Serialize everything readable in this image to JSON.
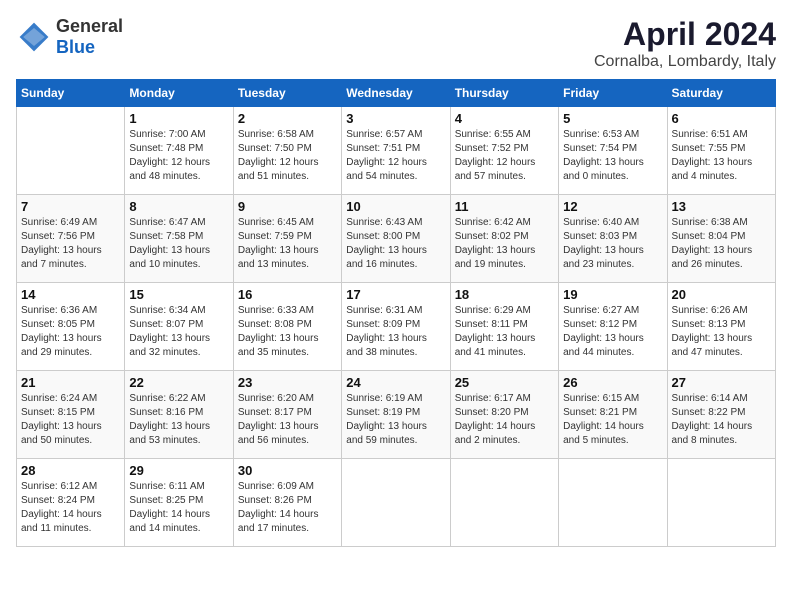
{
  "header": {
    "logo_general": "General",
    "logo_blue": "Blue",
    "month": "April 2024",
    "location": "Cornalba, Lombardy, Italy"
  },
  "weekdays": [
    "Sunday",
    "Monday",
    "Tuesday",
    "Wednesday",
    "Thursday",
    "Friday",
    "Saturday"
  ],
  "weeks": [
    [
      {
        "day": "",
        "sunrise": "",
        "sunset": "",
        "daylight": ""
      },
      {
        "day": "1",
        "sunrise": "Sunrise: 7:00 AM",
        "sunset": "Sunset: 7:48 PM",
        "daylight": "Daylight: 12 hours and 48 minutes."
      },
      {
        "day": "2",
        "sunrise": "Sunrise: 6:58 AM",
        "sunset": "Sunset: 7:50 PM",
        "daylight": "Daylight: 12 hours and 51 minutes."
      },
      {
        "day": "3",
        "sunrise": "Sunrise: 6:57 AM",
        "sunset": "Sunset: 7:51 PM",
        "daylight": "Daylight: 12 hours and 54 minutes."
      },
      {
        "day": "4",
        "sunrise": "Sunrise: 6:55 AM",
        "sunset": "Sunset: 7:52 PM",
        "daylight": "Daylight: 12 hours and 57 minutes."
      },
      {
        "day": "5",
        "sunrise": "Sunrise: 6:53 AM",
        "sunset": "Sunset: 7:54 PM",
        "daylight": "Daylight: 13 hours and 0 minutes."
      },
      {
        "day": "6",
        "sunrise": "Sunrise: 6:51 AM",
        "sunset": "Sunset: 7:55 PM",
        "daylight": "Daylight: 13 hours and 4 minutes."
      }
    ],
    [
      {
        "day": "7",
        "sunrise": "Sunrise: 6:49 AM",
        "sunset": "Sunset: 7:56 PM",
        "daylight": "Daylight: 13 hours and 7 minutes."
      },
      {
        "day": "8",
        "sunrise": "Sunrise: 6:47 AM",
        "sunset": "Sunset: 7:58 PM",
        "daylight": "Daylight: 13 hours and 10 minutes."
      },
      {
        "day": "9",
        "sunrise": "Sunrise: 6:45 AM",
        "sunset": "Sunset: 7:59 PM",
        "daylight": "Daylight: 13 hours and 13 minutes."
      },
      {
        "day": "10",
        "sunrise": "Sunrise: 6:43 AM",
        "sunset": "Sunset: 8:00 PM",
        "daylight": "Daylight: 13 hours and 16 minutes."
      },
      {
        "day": "11",
        "sunrise": "Sunrise: 6:42 AM",
        "sunset": "Sunset: 8:02 PM",
        "daylight": "Daylight: 13 hours and 19 minutes."
      },
      {
        "day": "12",
        "sunrise": "Sunrise: 6:40 AM",
        "sunset": "Sunset: 8:03 PM",
        "daylight": "Daylight: 13 hours and 23 minutes."
      },
      {
        "day": "13",
        "sunrise": "Sunrise: 6:38 AM",
        "sunset": "Sunset: 8:04 PM",
        "daylight": "Daylight: 13 hours and 26 minutes."
      }
    ],
    [
      {
        "day": "14",
        "sunrise": "Sunrise: 6:36 AM",
        "sunset": "Sunset: 8:05 PM",
        "daylight": "Daylight: 13 hours and 29 minutes."
      },
      {
        "day": "15",
        "sunrise": "Sunrise: 6:34 AM",
        "sunset": "Sunset: 8:07 PM",
        "daylight": "Daylight: 13 hours and 32 minutes."
      },
      {
        "day": "16",
        "sunrise": "Sunrise: 6:33 AM",
        "sunset": "Sunset: 8:08 PM",
        "daylight": "Daylight: 13 hours and 35 minutes."
      },
      {
        "day": "17",
        "sunrise": "Sunrise: 6:31 AM",
        "sunset": "Sunset: 8:09 PM",
        "daylight": "Daylight: 13 hours and 38 minutes."
      },
      {
        "day": "18",
        "sunrise": "Sunrise: 6:29 AM",
        "sunset": "Sunset: 8:11 PM",
        "daylight": "Daylight: 13 hours and 41 minutes."
      },
      {
        "day": "19",
        "sunrise": "Sunrise: 6:27 AM",
        "sunset": "Sunset: 8:12 PM",
        "daylight": "Daylight: 13 hours and 44 minutes."
      },
      {
        "day": "20",
        "sunrise": "Sunrise: 6:26 AM",
        "sunset": "Sunset: 8:13 PM",
        "daylight": "Daylight: 13 hours and 47 minutes."
      }
    ],
    [
      {
        "day": "21",
        "sunrise": "Sunrise: 6:24 AM",
        "sunset": "Sunset: 8:15 PM",
        "daylight": "Daylight: 13 hours and 50 minutes."
      },
      {
        "day": "22",
        "sunrise": "Sunrise: 6:22 AM",
        "sunset": "Sunset: 8:16 PM",
        "daylight": "Daylight: 13 hours and 53 minutes."
      },
      {
        "day": "23",
        "sunrise": "Sunrise: 6:20 AM",
        "sunset": "Sunset: 8:17 PM",
        "daylight": "Daylight: 13 hours and 56 minutes."
      },
      {
        "day": "24",
        "sunrise": "Sunrise: 6:19 AM",
        "sunset": "Sunset: 8:19 PM",
        "daylight": "Daylight: 13 hours and 59 minutes."
      },
      {
        "day": "25",
        "sunrise": "Sunrise: 6:17 AM",
        "sunset": "Sunset: 8:20 PM",
        "daylight": "Daylight: 14 hours and 2 minutes."
      },
      {
        "day": "26",
        "sunrise": "Sunrise: 6:15 AM",
        "sunset": "Sunset: 8:21 PM",
        "daylight": "Daylight: 14 hours and 5 minutes."
      },
      {
        "day": "27",
        "sunrise": "Sunrise: 6:14 AM",
        "sunset": "Sunset: 8:22 PM",
        "daylight": "Daylight: 14 hours and 8 minutes."
      }
    ],
    [
      {
        "day": "28",
        "sunrise": "Sunrise: 6:12 AM",
        "sunset": "Sunset: 8:24 PM",
        "daylight": "Daylight: 14 hours and 11 minutes."
      },
      {
        "day": "29",
        "sunrise": "Sunrise: 6:11 AM",
        "sunset": "Sunset: 8:25 PM",
        "daylight": "Daylight: 14 hours and 14 minutes."
      },
      {
        "day": "30",
        "sunrise": "Sunrise: 6:09 AM",
        "sunset": "Sunset: 8:26 PM",
        "daylight": "Daylight: 14 hours and 17 minutes."
      },
      {
        "day": "",
        "sunrise": "",
        "sunset": "",
        "daylight": ""
      },
      {
        "day": "",
        "sunrise": "",
        "sunset": "",
        "daylight": ""
      },
      {
        "day": "",
        "sunrise": "",
        "sunset": "",
        "daylight": ""
      },
      {
        "day": "",
        "sunrise": "",
        "sunset": "",
        "daylight": ""
      }
    ]
  ]
}
